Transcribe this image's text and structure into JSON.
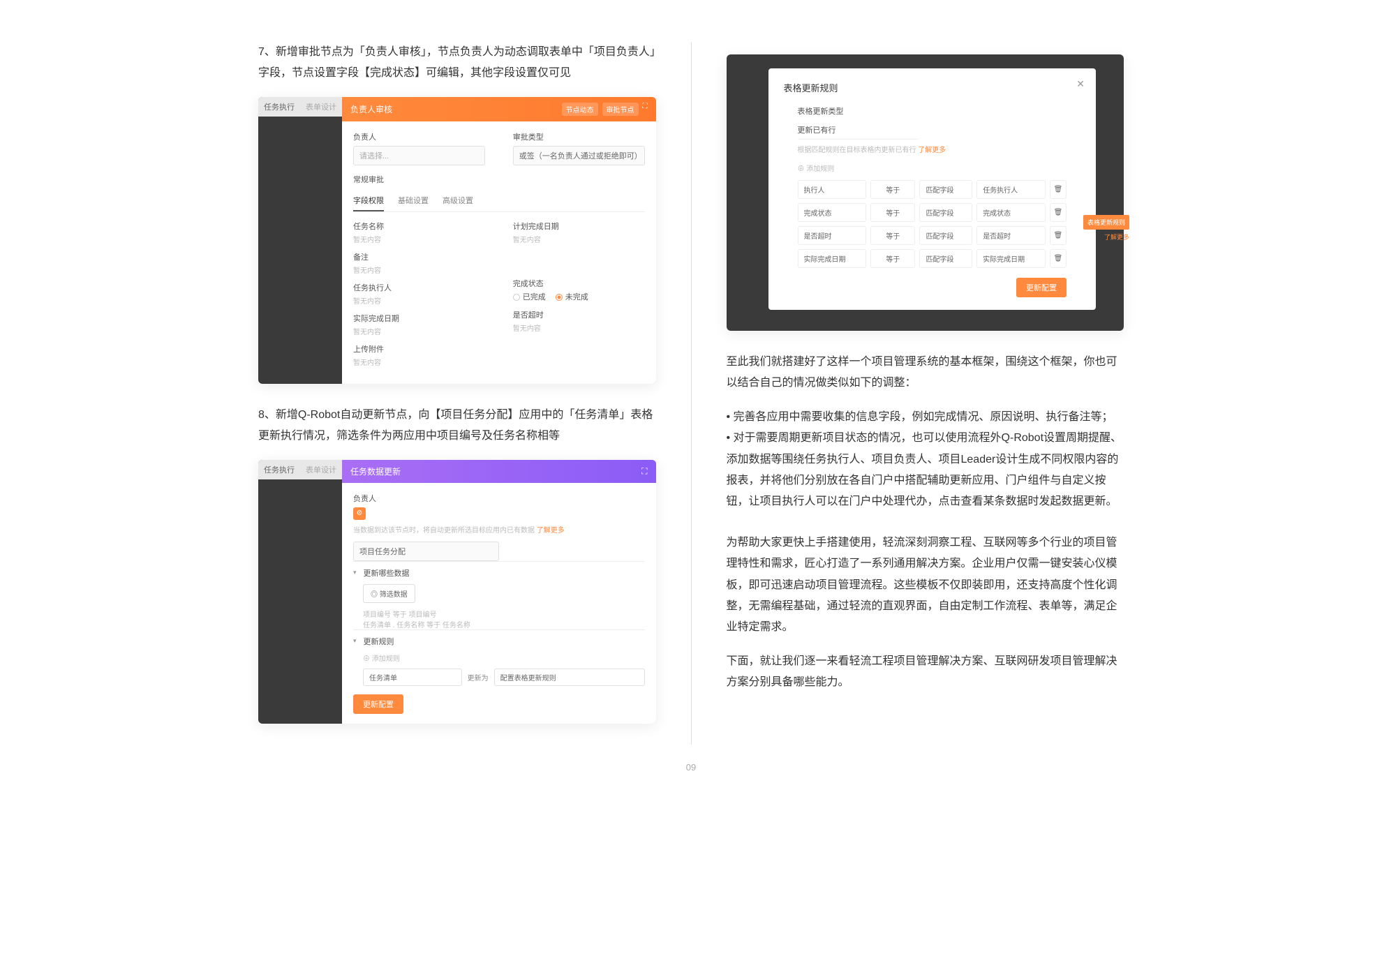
{
  "leftCol": {
    "p7": "7、新增审批节点为「负责人审核」，节点负责人为动态调取表单中「项目负责人」字段，节点设置字段【完成状态】可编辑，其他字段设置仅可见",
    "p8": "8、新增Q-Robot自动更新节点，向【项目任务分配】应用中的「任务清单」表格更新执行情况，筛选条件为两应用中项目编号及任务名称相等"
  },
  "shot1": {
    "leftLabel": "任务执行",
    "leftSub": "表单设计",
    "headerTitle": "负责人审核",
    "headerBadges": [
      "节点动态",
      "审批节点"
    ],
    "owner": {
      "label": "负责人",
      "placeholder": "请选择..."
    },
    "approval": {
      "label": "审批类型",
      "value": "或签（一名负责人通过或拒绝即可）"
    },
    "normalLabel": "常规审批",
    "tabs": [
      "字段权限",
      "基础设置",
      "高级设置"
    ],
    "fields": [
      {
        "label": "任务名称",
        "value": "暂无内容"
      },
      {
        "label": "计划完成日期",
        "value": "暂无内容"
      },
      {
        "label": "备注",
        "value": "暂无内容"
      },
      {
        "label": "任务执行人",
        "value": "暂无内容"
      },
      {
        "label": "完成状态",
        "radios": [
          "已完成",
          "未完成"
        ],
        "checked": 1
      },
      {
        "label": "实际完成日期",
        "value": "暂无内容"
      },
      {
        "label": "是否超时",
        "value": "暂无内容"
      },
      {
        "label": "上传附件",
        "value": "暂无内容"
      }
    ]
  },
  "shot2": {
    "leftLabel": "任务执行",
    "leftSub": "表单设计",
    "headerTitle": "任务数据更新",
    "owner": {
      "label": "负责人"
    },
    "hint": "当数据到达该节点时，将自动更新所选目标应用内已有数据",
    "hintLink": "了解更多",
    "targetApp": "项目任务分配",
    "sectionUpdate": "更新哪些数据",
    "filterBtn": "筛选数据",
    "filters": [
      {
        "field": "项目编号",
        "op": "等于",
        "value": "项目编号"
      },
      {
        "field": "任务清单 . 任务名称",
        "op": "等于",
        "value": "任务名称"
      }
    ],
    "sectionRules": "更新规则",
    "addRule": "添加规则",
    "ruleRow": {
      "field": "任务清单",
      "action": "更新为",
      "config": "配置表格更新规则"
    },
    "submitBtn": "更新配置"
  },
  "modal": {
    "title": "表格更新规则",
    "subLabel": "表格更新类型",
    "typeValue": "更新已有行",
    "help": "根据匹配规则在目标表格内更新已有行",
    "helpLink": "了解更多",
    "addRule": "添加规则",
    "rows": [
      {
        "field": "执行人",
        "op": "等于",
        "match": "匹配字段",
        "target": "任务执行人"
      },
      {
        "field": "完成状态",
        "op": "等于",
        "match": "匹配字段",
        "target": "完成状态"
      },
      {
        "field": "是否超时",
        "op": "等于",
        "match": "匹配字段",
        "target": "是否超时"
      },
      {
        "field": "实际完成日期",
        "op": "等于",
        "match": "匹配字段",
        "target": "实际完成日期"
      }
    ],
    "confirmBtn": "更新配置",
    "sideTag": "表格更新规则",
    "sideSub": "了解更多"
  },
  "rightText": {
    "p1": "至此我们就搭建好了这样一个项目管理系统的基本框架，围绕这个框架，你也可以结合自己的情况做类似如下的调整：",
    "b1": "• 完善各应用中需要收集的信息字段，例如完成情况、原因说明、执行备注等；",
    "b2": "• 对于需要周期更新项目状态的情况，也可以使用流程外Q-Robot设置周期提醒、添加数据等围绕任务执行人、项目负责人、项目Leader设计生成不同权限内容的报表，并将他们分别放在各自门户中搭配辅助更新应用、门户组件与自定义按钮，让项目执行人可以在门户中处理代办，点击查看某条数据时发起数据更新。",
    "p2": "为帮助大家更快上手搭建使用，轻流深刻洞察工程、互联网等多个行业的项目管理特性和需求，匠心打造了一系列通用解决方案。企业用户仅需一键安装心仪模板，即可迅速启动项目管理流程。这些模板不仅即装即用，还支持高度个性化调整，无需编程基础，通过轻流的直观界面，自由定制工作流程、表单等，满足企业特定需求。",
    "p3": "下面，就让我们逐一来看轻流工程项目管理解决方案、互联网研发项目管理解决方案分别具备哪些能力。"
  },
  "pageNum": "09"
}
